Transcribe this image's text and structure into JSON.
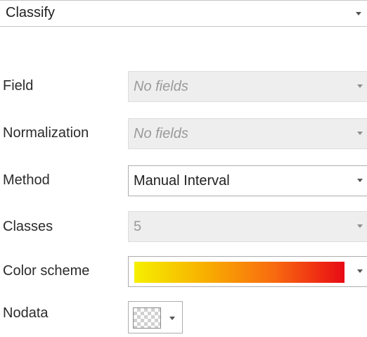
{
  "symbology": {
    "value": "Classify",
    "icon": "chevron-down-icon"
  },
  "rows": {
    "field": {
      "label": "Field",
      "value": "No fields",
      "enabled": false
    },
    "normalization": {
      "label": "Normalization",
      "value": "No fields",
      "enabled": false
    },
    "method": {
      "label": "Method",
      "value": "Manual Interval",
      "enabled": true
    },
    "classes": {
      "label": "Classes",
      "value": "5",
      "enabled": false
    },
    "color_scheme": {
      "label": "Color scheme",
      "gradient_colors": [
        "#f5f000",
        "#f8b000",
        "#f86a10",
        "#e80a14"
      ]
    },
    "nodata": {
      "label": "Nodata",
      "swatch": "transparent-checker"
    }
  },
  "colors": {
    "disabled_bg": "#eeeeee",
    "disabled_text": "#9a9a9a",
    "text": "#2b2b2b"
  }
}
